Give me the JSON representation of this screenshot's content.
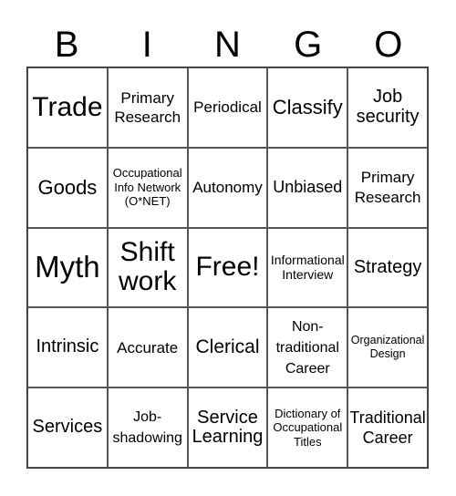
{
  "header": {
    "letters": [
      "B",
      "I",
      "N",
      "G",
      "O"
    ]
  },
  "board": {
    "rows": [
      [
        "Trade",
        "Primary\nResearch",
        "Periodical",
        "Classify",
        "Job\nsecurity"
      ],
      [
        "Goods",
        "Occupational\nInfo Network\n(O*NET)",
        "Autonomy",
        "Unbiased",
        "Primary\nResearch"
      ],
      [
        "Myth",
        "Shift\nwork",
        "Free!",
        "Informational\nInterview",
        "Strategy"
      ],
      [
        "Intrinsic",
        "Accurate",
        "Clerical",
        "Non-\ntraditional\nCareer",
        "Organizational\nDesign"
      ],
      [
        "Services",
        "Job-\nshadowing",
        "Service\nLearning",
        "Dictionary of\nOccupational\nTitles",
        "Traditional\nCareer"
      ]
    ],
    "free_space": "Free!"
  }
}
